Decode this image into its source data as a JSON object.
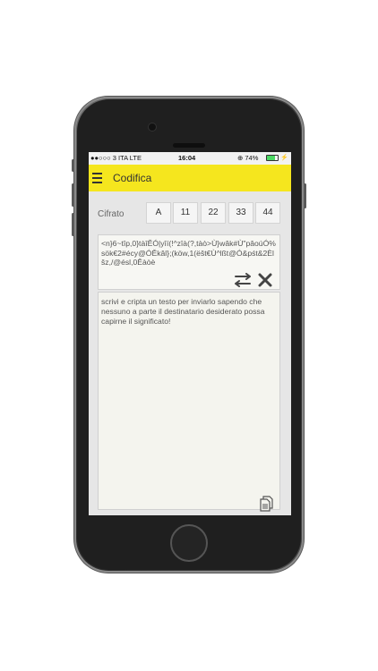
{
  "status_bar": {
    "carrier": "●●○○○ 3 ITA  LTE",
    "time": "16:04",
    "battery_text": "⊕ 74%",
    "battery_level": 0.74,
    "charging_symbol": "⚡"
  },
  "app_bar": {
    "title": "Codifica",
    "menu_icon": "hamburger-icon",
    "accent_color": "#f5e61e"
  },
  "key_selector": {
    "label": "Cifrato",
    "options": [
      "A",
      "11",
      "22",
      "33",
      "44"
    ]
  },
  "cipher_output": {
    "text": "<n}6~tîp,0}tàîĚÓ|yîí(!^zîà(?,tàò>Ù}wâk#Ù\"pâoúÓ%sök€2#écy@ÓĚkâl};(köw,1(ëšt€Ù^lßt@Ó&pśt&2Èlšz,/@ésl,0Ěàòè",
    "swap_icon": "swap-arrows-icon",
    "clear_icon": "close-icon"
  },
  "plain_input": {
    "text": "scrivi e cripta un testo per inviarlo sapendo che nessuno a parte il destinatario desiderato possa capirne il significato!",
    "copy_icon": "copy-icon"
  }
}
